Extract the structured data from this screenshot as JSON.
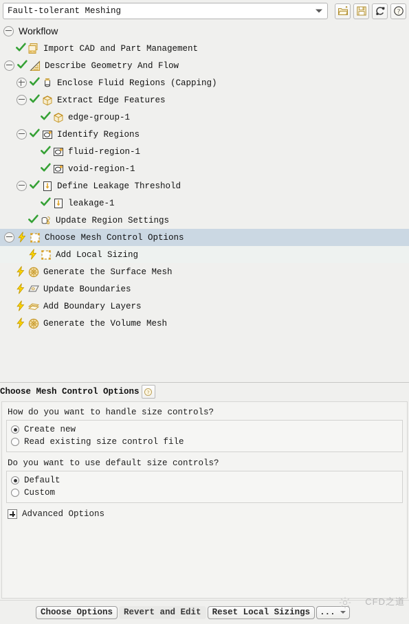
{
  "topbar": {
    "workflow_select_value": "Fault-tolerant Meshing",
    "buttons": [
      {
        "name": "open-workflow-button",
        "icon": "folder-open-icon",
        "title": "Open"
      },
      {
        "name": "save-workflow-button",
        "icon": "save-icon",
        "title": "Save"
      },
      {
        "name": "reset-workflow-button",
        "icon": "refresh-icon",
        "title": "Reset"
      },
      {
        "name": "help-button",
        "icon": "help-icon",
        "title": "Help"
      }
    ]
  },
  "tree": {
    "root_label": "Workflow",
    "root_expander": "minus",
    "items": [
      {
        "label": "Import CAD and Part Management",
        "indent": 1,
        "expander": "none",
        "status": "check",
        "icon": "cad-import-icon"
      },
      {
        "label": "Describe Geometry And Flow",
        "indent": 1,
        "expander": "minus",
        "status": "check",
        "icon": "geometry-icon"
      },
      {
        "label": "Enclose Fluid Regions (Capping)",
        "indent": 2,
        "expander": "plus",
        "status": "check",
        "icon": "capping-icon"
      },
      {
        "label": "Extract Edge Features",
        "indent": 2,
        "expander": "minus",
        "status": "check",
        "icon": "edge-feature-icon"
      },
      {
        "label": "edge-group-1",
        "indent": 3,
        "expander": "none",
        "status": "check",
        "icon": "edge-feature-icon"
      },
      {
        "label": "Identify Regions",
        "indent": 2,
        "expander": "minus",
        "status": "check",
        "icon": "region-icon"
      },
      {
        "label": "fluid-region-1",
        "indent": 3,
        "expander": "none",
        "status": "check",
        "icon": "region-icon"
      },
      {
        "label": "void-region-1",
        "indent": 3,
        "expander": "none",
        "status": "check",
        "icon": "region-icon"
      },
      {
        "label": "Define Leakage Threshold",
        "indent": 2,
        "expander": "minus",
        "status": "check",
        "icon": "leakage-icon"
      },
      {
        "label": "leakage-1",
        "indent": 3,
        "expander": "none",
        "status": "check",
        "icon": "leakage-icon"
      },
      {
        "label": "Update Region Settings",
        "indent": 2,
        "expander": "none",
        "status": "check",
        "icon": "update-region-icon"
      },
      {
        "label": "Choose Mesh Control Options",
        "indent": 1,
        "expander": "minus",
        "status": "bolt",
        "icon": "mesh-control-icon",
        "selected": true
      },
      {
        "label": "Add Local Sizing",
        "indent": 2,
        "expander": "none",
        "status": "bolt",
        "icon": "local-sizing-icon",
        "tinted": true
      },
      {
        "label": "Generate the Surface Mesh",
        "indent": 1,
        "expander": "none",
        "status": "bolt",
        "icon": "surface-mesh-icon"
      },
      {
        "label": "Update Boundaries",
        "indent": 1,
        "expander": "none",
        "status": "bolt",
        "icon": "boundaries-icon"
      },
      {
        "label": "Add Boundary Layers",
        "indent": 1,
        "expander": "none",
        "status": "bolt",
        "icon": "boundary-layer-icon"
      },
      {
        "label": "Generate the Volume Mesh",
        "indent": 1,
        "expander": "none",
        "status": "bolt",
        "icon": "volume-mesh-icon"
      }
    ]
  },
  "task": {
    "title": "Choose Mesh Control Options",
    "help_icon": "help-icon",
    "groups": [
      {
        "question": "How do you want to handle size controls?",
        "options": [
          {
            "label": "Create new",
            "selected": true
          },
          {
            "label": "Read existing size control file",
            "selected": false
          }
        ]
      },
      {
        "question": "Do you want to use default size controls?",
        "options": [
          {
            "label": "Default",
            "selected": true
          },
          {
            "label": "Custom",
            "selected": false
          }
        ]
      }
    ],
    "advanced_label": "Advanced Options",
    "advanced_expander": "plus"
  },
  "buttonbar": {
    "buttons": [
      {
        "label": "Choose Options",
        "style": "normal",
        "name": "choose-options-button"
      },
      {
        "label": "Revert and Edit",
        "style": "flat",
        "name": "revert-and-edit-button"
      },
      {
        "label": "Reset Local Sizings",
        "style": "normal",
        "name": "reset-local-sizings-button"
      },
      {
        "label": "...",
        "style": "dots",
        "name": "more-options-button"
      }
    ]
  },
  "watermark": {
    "text": "CFD之道"
  },
  "colors": {
    "window_bg": "#f0f0ee",
    "selection": "#cbd8e3",
    "check_green": "#35a135",
    "bolt_yellow": "#ffd800",
    "icon_gold": "#c79a2e"
  }
}
